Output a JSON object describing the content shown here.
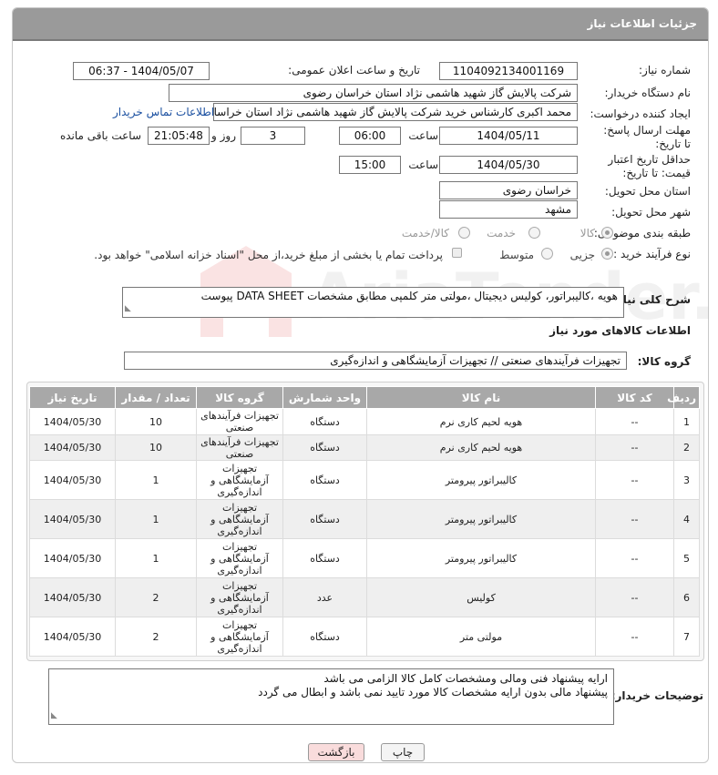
{
  "header": {
    "title": "جزئیات اطلاعات نیاز"
  },
  "form": {
    "need_number_label": "شماره نیاز:",
    "need_number": "1104092134001169",
    "announce_label": "تاریخ و ساعت اعلان عمومی:",
    "announce_value": "1404/05/07 - 06:37",
    "buyer_org_label": "نام دستگاه خریدار:",
    "buyer_org": "شرکت پالایش گاز شهید هاشمی نژاد   استان خراسان رضوی",
    "requester_label": "ایجاد کننده درخواست:",
    "requester": "محمد اکبری کارشناس خرید شرکت پالایش گاز شهید هاشمی نژاد   استان خراسان رضوی",
    "contact_link": "اطلاعات تماس خریدار",
    "reply_deadline_label": "مهلت ارسال پاسخ: تا تاریخ:",
    "reply_date": "1404/05/11",
    "hour_label": "ساعت",
    "reply_time": "06:00",
    "days_value": "3",
    "days_label": "روز و",
    "remaining_time": "21:05:48",
    "remaining_label": "ساعت باقی مانده",
    "price_validity_label": "حداقل تاریخ اعتبار قیمت: تا تاریخ:",
    "price_date": "1404/05/30",
    "price_time": "15:00",
    "province_label": "استان محل تحویل:",
    "province": "خراسان رضوی",
    "city_label": "شهر محل تحویل:",
    "city": "مشهد",
    "category_label": "طبقه بندی موضوعی:",
    "category_options": [
      "کالا",
      "خدمت",
      "کالا/خدمت"
    ],
    "process_label": "نوع فرآیند خرید :",
    "process_options": [
      "جزیی",
      "متوسط"
    ],
    "payment_note": "پرداخت تمام یا بخشی از مبلغ خرید،از محل \"اسناد خزانه اسلامی\" خواهد بود.",
    "description_label": "شرح کلی نیاز:",
    "description": "هویه ،کالیبراتور، کولیس دیجیتال ،مولتی متر کلمپی مطابق مشخصات DATA SHEET پیوست"
  },
  "goods": {
    "section_title": "اطلاعات کالاهای مورد نیاز",
    "group_label": "گروه کالا:",
    "group_value": "تجهیزات فرآیندهای صنعتی // تجهیزات آزمایشگاهی و اندازه‌گیری",
    "columns": [
      "ردیف",
      "کد کالا",
      "نام کالا",
      "واحد شمارش",
      "گروه کالا",
      "تعداد / مقدار",
      "تاریخ نیاز"
    ],
    "rows": [
      {
        "row": "1",
        "code": "--",
        "name": "هویه لحیم کاری نرم",
        "unit": "دستگاه",
        "group": "تجهیزات فرآیندهای صنعتی",
        "qty": "10",
        "date": "1404/05/30"
      },
      {
        "row": "2",
        "code": "--",
        "name": "هویه لحیم کاری نرم",
        "unit": "دستگاه",
        "group": "تجهیزات فرآیندهای صنعتی",
        "qty": "10",
        "date": "1404/05/30"
      },
      {
        "row": "3",
        "code": "--",
        "name": "کالیبراتور پیرومتر",
        "unit": "دستگاه",
        "group": "تجهیزات آزمایشگاهی و اندازه‌گیری",
        "qty": "1",
        "date": "1404/05/30"
      },
      {
        "row": "4",
        "code": "--",
        "name": "کالیبراتور پیرومتر",
        "unit": "دستگاه",
        "group": "تجهیزات آزمایشگاهی و اندازه‌گیری",
        "qty": "1",
        "date": "1404/05/30"
      },
      {
        "row": "5",
        "code": "--",
        "name": "کالیبراتور پیرومتر",
        "unit": "دستگاه",
        "group": "تجهیزات آزمایشگاهی و اندازه‌گیری",
        "qty": "1",
        "date": "1404/05/30"
      },
      {
        "row": "6",
        "code": "--",
        "name": "کولیس",
        "unit": "عدد",
        "group": "تجهیزات آزمایشگاهی و اندازه‌گیری",
        "qty": "2",
        "date": "1404/05/30"
      },
      {
        "row": "7",
        "code": "--",
        "name": "مولتی متر",
        "unit": "دستگاه",
        "group": "تجهیزات آزمایشگاهی و اندازه‌گیری",
        "qty": "2",
        "date": "1404/05/30"
      }
    ]
  },
  "buyer_notes": {
    "label": "توضیحات خریدار:",
    "line1": "ارایه پیشنهاد فنی ومالی ومشخصات کامل کالا الزامی می باشد",
    "line2": "پیشنهاد مالی بدون ارایه مشخصات کالا مورد تایید نمی باشد و ابطال می گردد"
  },
  "buttons": {
    "print": "چاپ",
    "back": "بازگشت"
  },
  "watermark": {
    "text": "AriaTender.net"
  }
}
